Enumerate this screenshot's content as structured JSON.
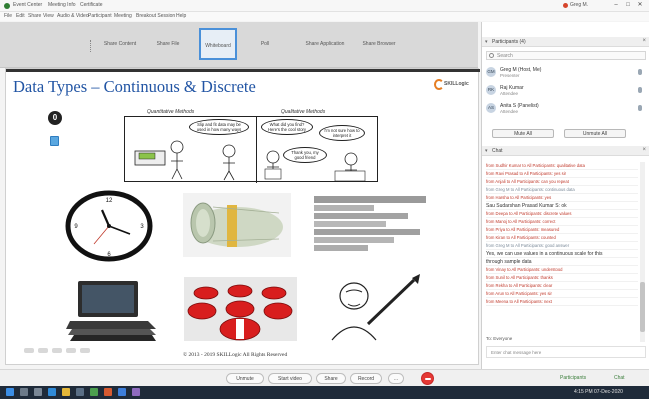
{
  "window": {
    "tabs": [
      "Event Center",
      "Meeting Info",
      "Certificate"
    ],
    "user_label": "Greg M.",
    "min_label": "–",
    "max_label": "□",
    "close_label": "✕"
  },
  "menu": [
    "File",
    "Edit",
    "Share",
    "View",
    "Audio & Video",
    "Participant",
    "Meeting",
    "Breakout Session",
    "Help"
  ],
  "toolbar": {
    "buttons": [
      "Share Content",
      "Share File",
      "Whiteboard",
      "Poll",
      "Share Application",
      "Share Browser"
    ]
  },
  "slide": {
    "title": "Data Types – Continuous & Discrete",
    "logo_text": "SKILLogic",
    "slide_number": "0",
    "comic_caption_left": "Quantitative Methods",
    "comic_caption_right": "Qualitative Methods",
    "speech_1": "Slip and fit data may be used in how many ways",
    "speech_2": "What did you find? Here's the cool story",
    "speech_3": "I'm not sure how to interpret it",
    "speech_4": "Thank you, my good friend",
    "copyright": "© 2013 - 2019 SKILLogic All Rights Reserved"
  },
  "panel": {
    "participants_header": "Participants (4)",
    "search_placeholder": "Search",
    "participants": [
      {
        "initials": "GM",
        "name": "Greg M (Host, Me)",
        "sub": "Presenter"
      },
      {
        "initials": "RK",
        "name": "Raj Kumar",
        "sub": "Attendee"
      },
      {
        "initials": "AS",
        "name": "Anita S (Panelist)",
        "sub": "Attendee"
      }
    ],
    "mute_all_label": "Mute All",
    "unmute_all_label": "Unmute All",
    "chat_header": "Chat",
    "chat_messages": [
      {
        "text": "from Sudhir Kumar to All Participants: qualitative data",
        "style": "red"
      },
      {
        "text": "from Ravi Prasad to All Participants: yes sir",
        "style": "red"
      },
      {
        "text": "from Anjali to All Participants: can you repeat",
        "style": "red"
      },
      {
        "text": "from Greg M to All Participants: continuous data",
        "style": "sys"
      },
      {
        "text": "from Harsha to All Participants: yes",
        "style": "red"
      },
      {
        "text": "Sau Sudarshan Prasad Kumar S: ok",
        "style": "dark"
      },
      {
        "text": "from Deepa to All Participants: discrete values",
        "style": "red"
      },
      {
        "text": "from Manoj to All Participants: correct",
        "style": "red"
      },
      {
        "text": "from Priya to All Participants: measured",
        "style": "red"
      },
      {
        "text": "from Kiran to All Participants: counted",
        "style": "red"
      },
      {
        "text": "from Greg M to All Participants: good answer",
        "style": "sys"
      },
      {
        "text": "Yes, we can use values in a continuous scale for this",
        "style": "dark"
      },
      {
        "text": "through sample data",
        "style": "dark"
      },
      {
        "text": "from Vinay to All Participants: understood",
        "style": "red"
      },
      {
        "text": "from Sunil to All Participants: thanks",
        "style": "red"
      },
      {
        "text": "from Rekha to All Participants: clear",
        "style": "red"
      },
      {
        "text": "from Arun to All Participants: yes sir",
        "style": "red"
      },
      {
        "text": "from Meena to All Participants: next",
        "style": "red"
      }
    ],
    "send_to_label": "To: Everyone",
    "chat_input_placeholder": "Enter chat message here"
  },
  "controls": {
    "unmute_label": "Unmute",
    "video_label": "Start video",
    "share_label": "Share",
    "record_label": "Record",
    "more_label": "...",
    "participants_label": "Participants",
    "chat_label": "Chat"
  },
  "taskbar": {
    "clock": "4:15 PM 07-Dec-2020"
  }
}
